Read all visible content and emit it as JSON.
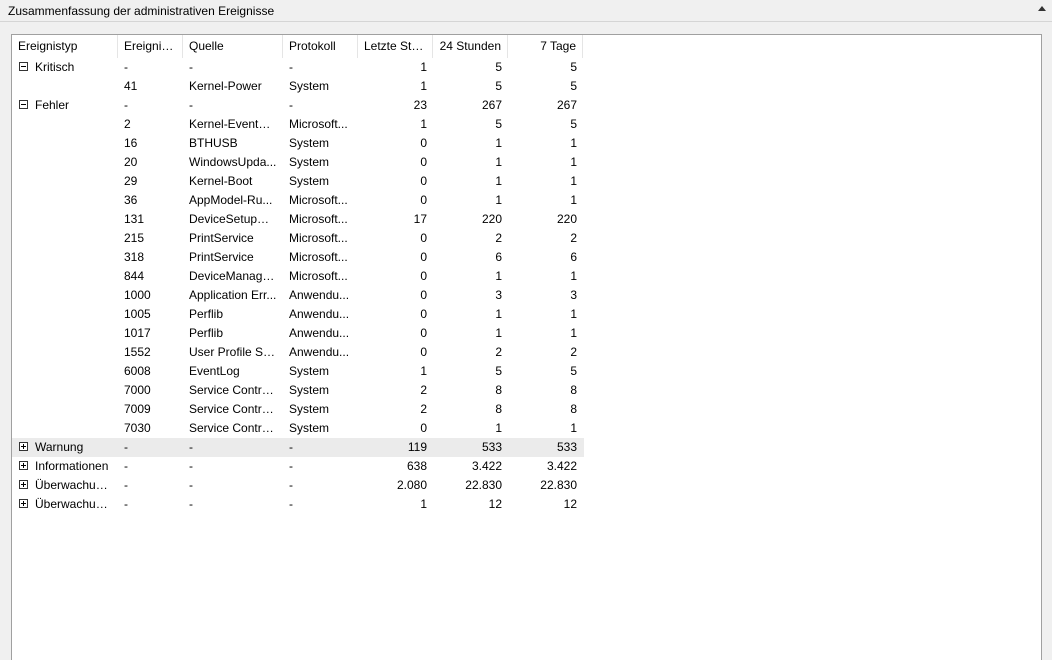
{
  "window": {
    "title": "Zusammenfassung der administrativen Ereignisse",
    "collapse_icon": "chevron-up-icon"
  },
  "columns": [
    "Ereignistyp",
    "Ereignis...",
    "Quelle",
    "Protokoll",
    "Letzte Stu...",
    "24 Stunden",
    "7 Tage"
  ],
  "rows": [
    {
      "group": true,
      "expanded": true,
      "type": "Kritisch",
      "id": "-",
      "source": "-",
      "log": "-",
      "hour": "1",
      "day": "5",
      "week": "5"
    },
    {
      "group": false,
      "type": "",
      "id": "41",
      "source": "Kernel-Power",
      "log": "System",
      "hour": "1",
      "day": "5",
      "week": "5"
    },
    {
      "group": true,
      "expanded": true,
      "type": "Fehler",
      "id": "-",
      "source": "-",
      "log": "-",
      "hour": "23",
      "day": "267",
      "week": "267"
    },
    {
      "group": false,
      "type": "",
      "id": "2",
      "source": "Kernel-EventTr...",
      "log": "Microsoft...",
      "hour": "1",
      "day": "5",
      "week": "5"
    },
    {
      "group": false,
      "type": "",
      "id": "16",
      "source": "BTHUSB",
      "log": "System",
      "hour": "0",
      "day": "1",
      "week": "1"
    },
    {
      "group": false,
      "type": "",
      "id": "20",
      "source": "WindowsUpda...",
      "log": "System",
      "hour": "0",
      "day": "1",
      "week": "1"
    },
    {
      "group": false,
      "type": "",
      "id": "29",
      "source": "Kernel-Boot",
      "log": "System",
      "hour": "0",
      "day": "1",
      "week": "1"
    },
    {
      "group": false,
      "type": "",
      "id": "36",
      "source": "AppModel-Ru...",
      "log": "Microsoft...",
      "hour": "0",
      "day": "1",
      "week": "1"
    },
    {
      "group": false,
      "type": "",
      "id": "131",
      "source": "DeviceSetupM...",
      "log": "Microsoft...",
      "hour": "17",
      "day": "220",
      "week": "220"
    },
    {
      "group": false,
      "type": "",
      "id": "215",
      "source": "PrintService",
      "log": "Microsoft...",
      "hour": "0",
      "day": "2",
      "week": "2"
    },
    {
      "group": false,
      "type": "",
      "id": "318",
      "source": "PrintService",
      "log": "Microsoft...",
      "hour": "0",
      "day": "6",
      "week": "6"
    },
    {
      "group": false,
      "type": "",
      "id": "844",
      "source": "DeviceManage...",
      "log": "Microsoft...",
      "hour": "0",
      "day": "1",
      "week": "1"
    },
    {
      "group": false,
      "type": "",
      "id": "1000",
      "source": "Application Err...",
      "log": "Anwendu...",
      "hour": "0",
      "day": "3",
      "week": "3"
    },
    {
      "group": false,
      "type": "",
      "id": "1005",
      "source": "Perflib",
      "log": "Anwendu...",
      "hour": "0",
      "day": "1",
      "week": "1"
    },
    {
      "group": false,
      "type": "",
      "id": "1017",
      "source": "Perflib",
      "log": "Anwendu...",
      "hour": "0",
      "day": "1",
      "week": "1"
    },
    {
      "group": false,
      "type": "",
      "id": "1552",
      "source": "User Profile Ser...",
      "log": "Anwendu...",
      "hour": "0",
      "day": "2",
      "week": "2"
    },
    {
      "group": false,
      "type": "",
      "id": "6008",
      "source": "EventLog",
      "log": "System",
      "hour": "1",
      "day": "5",
      "week": "5"
    },
    {
      "group": false,
      "type": "",
      "id": "7000",
      "source": "Service Contro...",
      "log": "System",
      "hour": "2",
      "day": "8",
      "week": "8"
    },
    {
      "group": false,
      "type": "",
      "id": "7009",
      "source": "Service Contro...",
      "log": "System",
      "hour": "2",
      "day": "8",
      "week": "8"
    },
    {
      "group": false,
      "type": "",
      "id": "7030",
      "source": "Service Contro...",
      "log": "System",
      "hour": "0",
      "day": "1",
      "week": "1"
    },
    {
      "group": true,
      "expanded": false,
      "highlight": true,
      "type": "Warnung",
      "id": "-",
      "source": "-",
      "log": "-",
      "hour": "119",
      "day": "533",
      "week": "533"
    },
    {
      "group": true,
      "expanded": false,
      "type": "Informationen",
      "id": "-",
      "source": "-",
      "log": "-",
      "hour": "638",
      "day": "3.422",
      "week": "3.422"
    },
    {
      "group": true,
      "expanded": false,
      "type": "Überwachun...",
      "id": "-",
      "source": "-",
      "log": "-",
      "hour": "2.080",
      "day": "22.830",
      "week": "22.830"
    },
    {
      "group": true,
      "expanded": false,
      "type": "Überwachun...",
      "id": "-",
      "source": "-",
      "log": "-",
      "hour": "1",
      "day": "12",
      "week": "12"
    }
  ]
}
